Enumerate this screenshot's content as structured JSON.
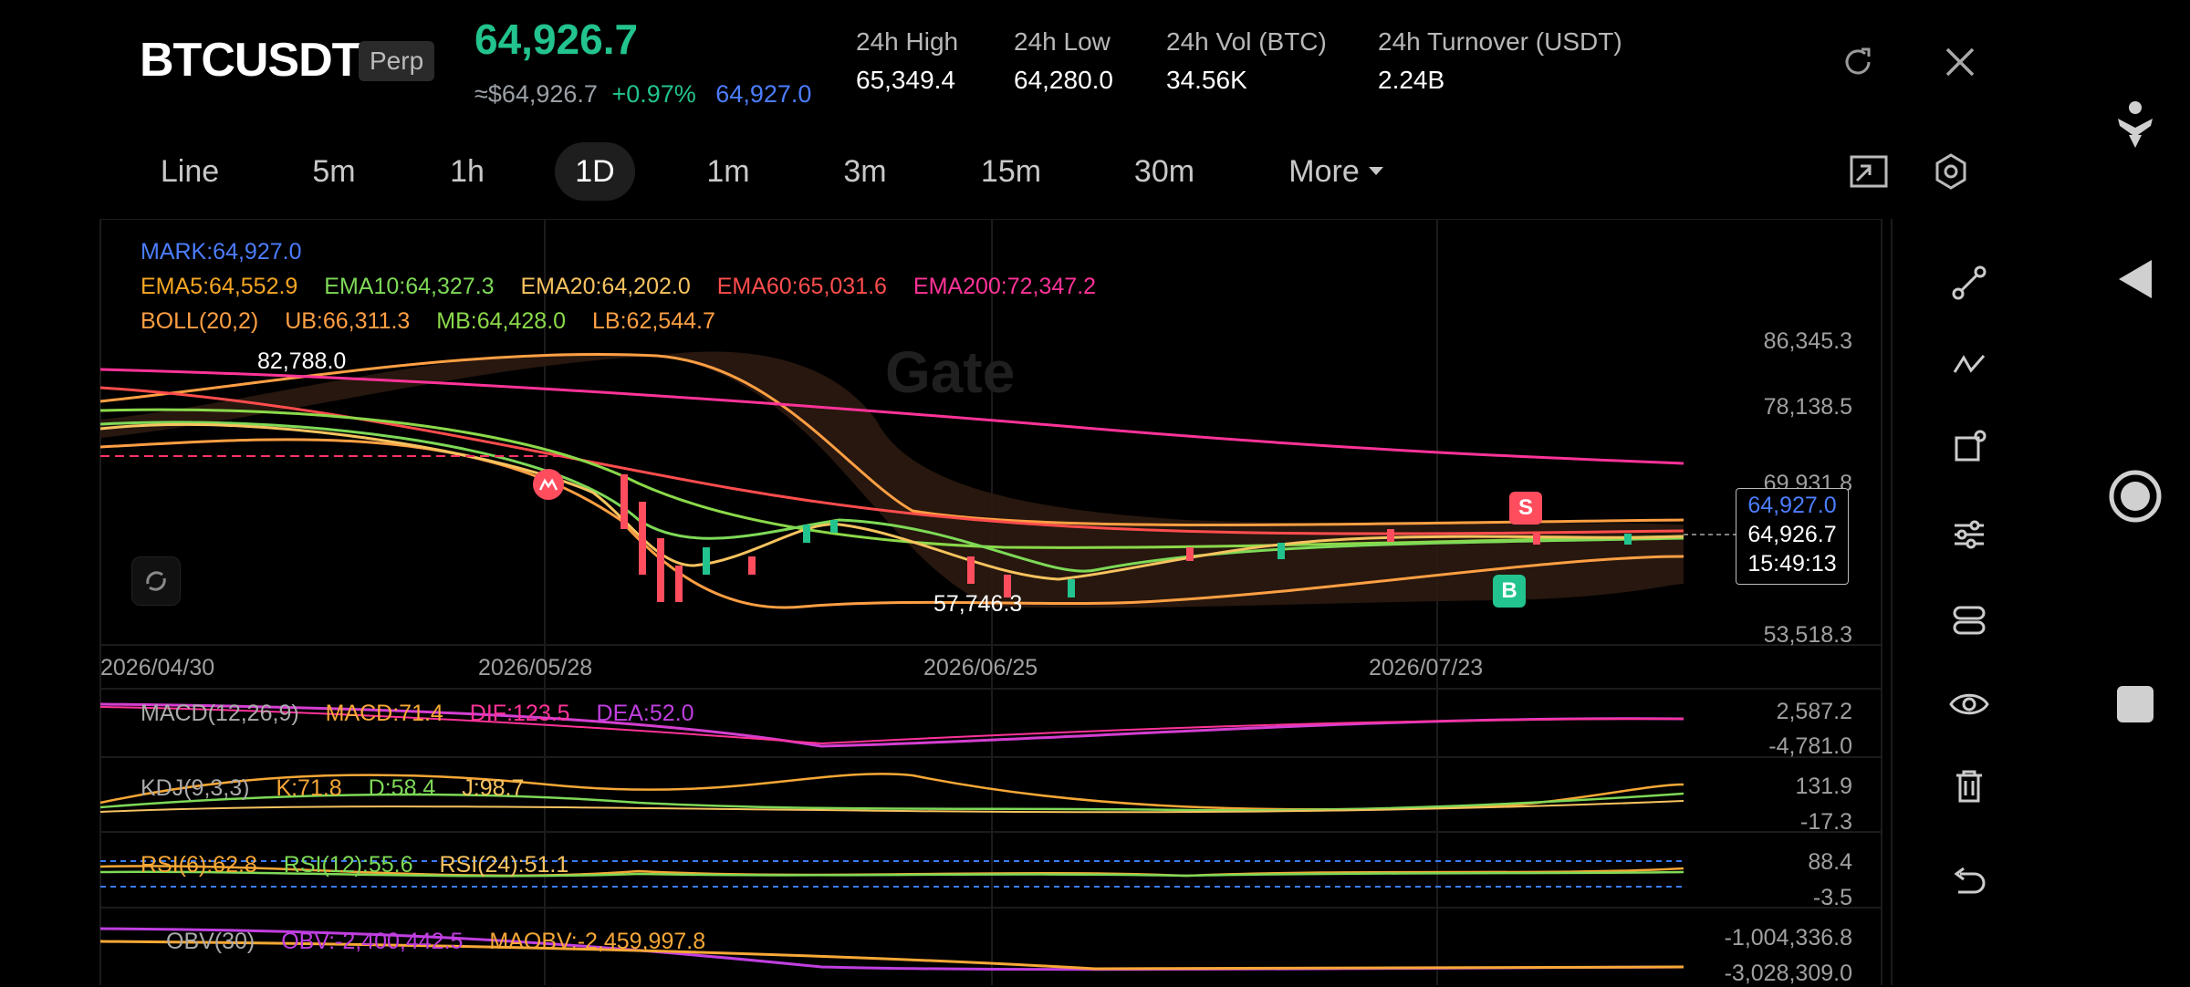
{
  "header": {
    "symbol": "BTCUSDT",
    "badge": "Perp",
    "last_price": "64,926.7",
    "approx_price": "≈$64,926.7",
    "change_pct": "+0.97%",
    "mark_price": "64,927.0",
    "stats": [
      {
        "label": "24h  High",
        "value": "65,349.4"
      },
      {
        "label": "24h  Low",
        "value": "64,280.0"
      },
      {
        "label": "24h  Vol (BTC)",
        "value": "34.56K"
      },
      {
        "label": "24h  Turnover (USDT)",
        "value": "2.24B"
      }
    ],
    "icons": [
      "refresh-icon",
      "close-icon"
    ]
  },
  "timeframes": {
    "items": [
      "Line",
      "5m",
      "1h",
      "1D",
      "1m",
      "3m",
      "15m",
      "30m",
      "More"
    ],
    "active": "1D"
  },
  "toolbar_icons": [
    "fullscreen-toggle-icon",
    "chart-settings-icon"
  ],
  "indicators": {
    "mark": "MARK:64,927.0",
    "ema": [
      "EMA5:64,552.9",
      "EMA10:64,327.3",
      "EMA20:64,202.0",
      "EMA60:65,031.6",
      "EMA200:72,347.2"
    ],
    "boll": [
      "BOLL(20,2)",
      "UB:66,311.3",
      "MB:64,428.0",
      "LB:62,544.7"
    ],
    "colors": {
      "mark": "#4c7dff",
      "ema5": "#f5a623",
      "ema10": "#7ed957",
      "ema20": "#f7c35f",
      "ema60": "#ff4d4d",
      "ema200": "#ff3399",
      "boll": "#ff9f43",
      "mb": "#8bd94a"
    }
  },
  "main_chart": {
    "watermark": "Gate",
    "y_axis": [
      "86,345.3",
      "78,138.5",
      "69,931.8",
      "53,518.3"
    ],
    "x_axis": [
      "2026/04/30",
      "2026/05/28",
      "2026/06/25",
      "2026/07/23"
    ],
    "high_label": "82,788.0",
    "low_label": "57,746.3",
    "current_box": {
      "mark": "64,927.0",
      "last": "64,926.7",
      "countdown": "15:49:13"
    },
    "markers": {
      "sell": "S",
      "buy": "B"
    }
  },
  "sub_panels": [
    {
      "name": "macd",
      "labels": [
        "MACD(12,26,9)",
        "MACD:71.4",
        "DIF:123.5",
        "DEA:52.0"
      ],
      "axis": [
        "2,587.2",
        "-4,781.0"
      ]
    },
    {
      "name": "kdj",
      "labels": [
        "KDJ(9,3,3)",
        "K:71.8",
        "D:58.4",
        "J:98.7"
      ],
      "axis": [
        "131.9",
        "-17.3"
      ]
    },
    {
      "name": "rsi",
      "labels": [
        "RSI(6):62.8",
        "RSI(12):55.6",
        "RSI(24):51.1"
      ],
      "axis": [
        "88.4",
        "-3.5"
      ]
    },
    {
      "name": "obv",
      "labels": [
        "OBV(30)",
        "OBV:-2,400,442.5",
        "MAOBV:-2,459,997.8"
      ],
      "axis": [
        "-1,004,336.8",
        "-3,028,309.0"
      ]
    }
  ],
  "drawing_tools": [
    "trend-line-icon",
    "fib-tool-icon",
    "shape-tool-icon",
    "indicator-settings-icon",
    "layout-settings-icon",
    "visibility-icon",
    "delete-icon",
    "undo-icon"
  ],
  "system_nav": [
    "accessibility-icon",
    "back-icon",
    "home-icon",
    "recents-icon"
  ]
}
